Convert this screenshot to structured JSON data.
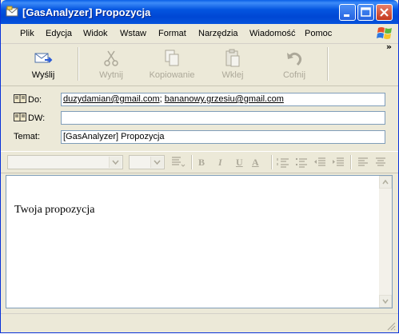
{
  "window": {
    "title": "[GasAnalyzer] Propozycja",
    "icon": "mail-envelope-icon",
    "controls": [
      "minimize-icon",
      "maximize-icon",
      "close-icon"
    ]
  },
  "menu": {
    "items": [
      "Plik",
      "Edycja",
      "Widok",
      "Wstaw",
      "Format",
      "Narzędzia",
      "Wiadomość",
      "Pomoc"
    ],
    "overflow": "»"
  },
  "toolbar": {
    "send": {
      "label": "Wyślij",
      "icon": "send-icon"
    },
    "cut": {
      "label": "Wytnij",
      "icon": "scissors-icon"
    },
    "copy": {
      "label": "Kopiowanie",
      "icon": "copy-icon"
    },
    "paste": {
      "label": "Wklej",
      "icon": "paste-icon"
    },
    "undo": {
      "label": "Cofnij",
      "icon": "undo-icon"
    }
  },
  "fields": {
    "to_label": "Do:",
    "to_addr1": "duzydamian@gmail.com",
    "to_sep": ";",
    "to_addr2": "bananowy.grzesiu@gmail.com",
    "cc_label": "DW:",
    "cc_value": "",
    "subject_label": "Temat:",
    "subject_value": "[GasAnalyzer] Propozycja"
  },
  "format_bar": {
    "buttons": [
      "B",
      "I",
      "U",
      "A"
    ]
  },
  "body": {
    "text": "Twoja propozycja"
  },
  "colors": {
    "titlebar": "#0455e0",
    "chrome": "#ece9d8",
    "input_border": "#7f9db9",
    "disabled_text": "#aca899"
  }
}
